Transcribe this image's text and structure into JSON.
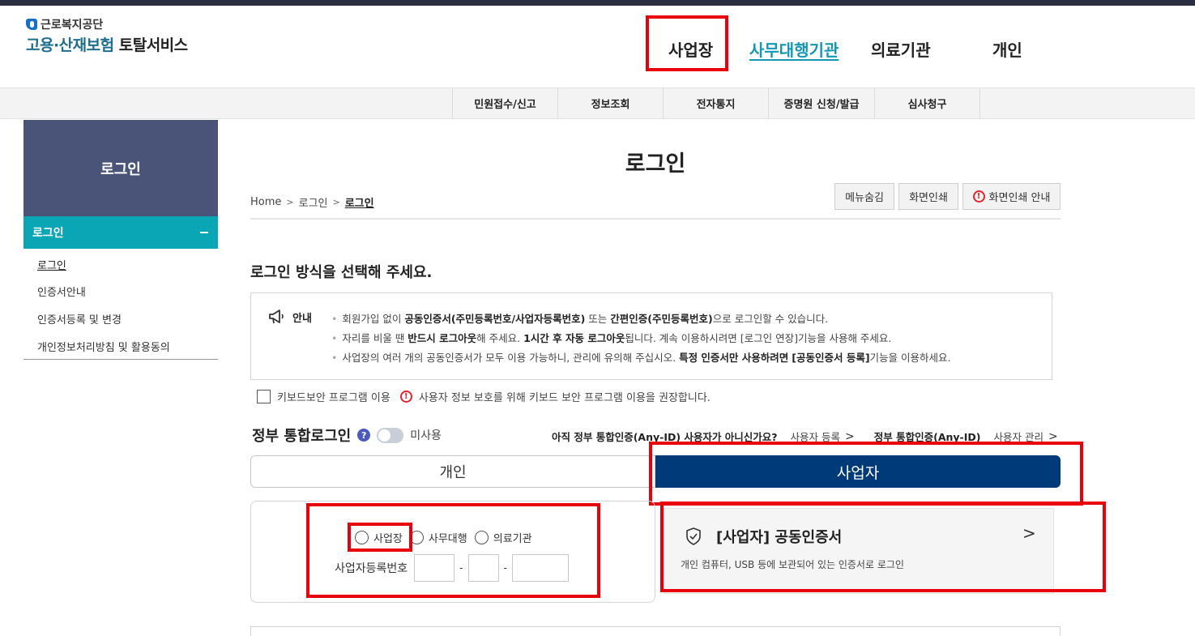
{
  "header": {
    "org_name": "근로복지공단",
    "service_title_part1": "고용·산재보험",
    "service_title_part2": "토탈서비스",
    "nav": [
      "사업장",
      "사무대행기관",
      "의료기관",
      "개인"
    ]
  },
  "subnav": [
    "민원접수/신고",
    "정보조회",
    "전자통지",
    "증명원 신청/발급",
    "심사청구"
  ],
  "sidebar": {
    "title": "로그인",
    "section": "로그인",
    "items": [
      "로그인",
      "인증서안내",
      "인증서등록 및 변경",
      "개인정보처리방침 및 활용동의"
    ]
  },
  "page": {
    "title": "로그인",
    "breadcrumb": [
      "Home",
      "로그인",
      "로그인"
    ],
    "util_buttons": [
      "메뉴숨김",
      "화면인쇄",
      "화면인쇄 안내"
    ]
  },
  "login": {
    "section_title": "로그인 방식을 선택해 주세요.",
    "notice_label": "안내",
    "notice_lines": [
      {
        "pre": "회원가입 없이 ",
        "b1": "공동인증서(주민등록번호/사업자등록번호)",
        "mid": " 또는 ",
        "b2": "간편인증(주민등록번호)",
        "post": "으로 로그인할 수 있습니다."
      },
      {
        "pre": "자리를 비울 땐 ",
        "b1": "반드시 로그아웃",
        "mid": "해 주세요. ",
        "b2": "1시간 후 자동 로그아웃",
        "post": "됩니다. 계속 이용하시려면 [로그인 연장]기능을 사용해 주세요."
      },
      {
        "pre": "사업장의 여러 개의 공동인증서가 모두 이용 가능하니, 관리에 유의해 주십시오. ",
        "b1": "특정 인증서만 사용하려면",
        "mid": " ",
        "b2": "[공동인증서 등록]",
        "post": "기능을 이용하세요."
      }
    ],
    "keyboard_label": "키보드보안 프로그램 이용",
    "keyboard_notice": "사용자 정보 보호를 위해 키보드 보안 프로그램 이용을 권장합니다.",
    "gov_login_title": "정부 통합로그인",
    "toggle_label": "미사용",
    "anyid_question": "아직 정부 통합인증(Any-ID) 사용자가 아니신가요?",
    "anyid_register": "사용자 등록",
    "anyid_title": "정부 통합인증(Any-ID)",
    "anyid_manage": "사용자 관리",
    "tabs": [
      "개인",
      "사업자"
    ],
    "radio_options": [
      "사업장",
      "사무대행",
      "의료기관"
    ],
    "bizno_label": "사업자등록번호",
    "bizno_sep": "-",
    "cert_title": "[사업자] 공동인증서",
    "cert_desc": "개인 컴퓨터, USB 등에 보관되어 있는 인증서로 로그인"
  }
}
